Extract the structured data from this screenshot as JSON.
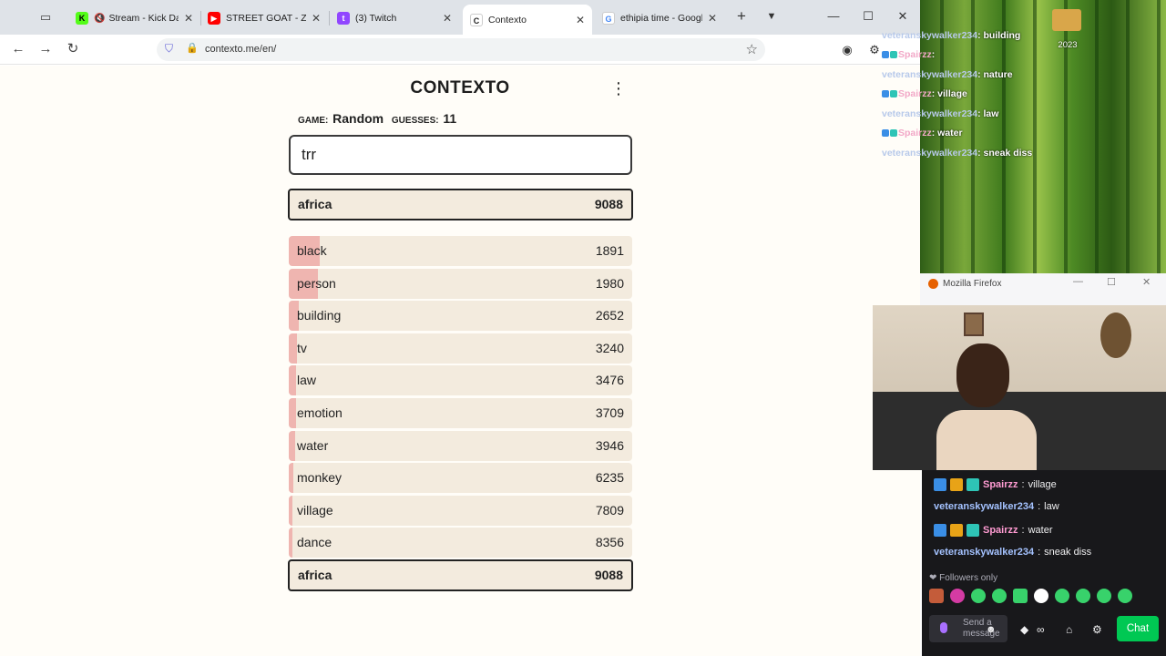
{
  "browser": {
    "tabs": [
      {
        "title": "Stream - Kick Dashboard",
        "favicon": "kick-icon",
        "color": "#53fc18",
        "muted": true
      },
      {
        "title": "STREET GOAT - ZEOTE",
        "favicon": "youtube-icon",
        "color": "#ff0000"
      },
      {
        "title": "(3) Twitch",
        "favicon": "twitch-icon",
        "color": "#9146ff"
      },
      {
        "title": "Contexto",
        "favicon": "contexto-icon",
        "color": "#222222",
        "active": true
      },
      {
        "title": "ethipia time - Google",
        "favicon": "google-icon",
        "color": "#4285f4"
      }
    ],
    "url": "contexto.me/en/"
  },
  "game": {
    "title": "CONTEXTO",
    "game_label": "GAME:",
    "game_value": "Random",
    "guesses_label": "GUESSES:",
    "guesses_value": "11",
    "input_value": "trr",
    "last_guess": {
      "word": "africa",
      "rank": "9088"
    },
    "guesses": [
      {
        "word": "black",
        "rank": "1891",
        "closeness": 0.09
      },
      {
        "word": "person",
        "rank": "1980",
        "closeness": 0.085
      },
      {
        "word": "building",
        "rank": "2652",
        "closeness": 0.03
      },
      {
        "word": "tv",
        "rank": "3240",
        "closeness": 0.025
      },
      {
        "word": "law",
        "rank": "3476",
        "closeness": 0.022
      },
      {
        "word": "emotion",
        "rank": "3709",
        "closeness": 0.02
      },
      {
        "word": "water",
        "rank": "3946",
        "closeness": 0.018
      },
      {
        "word": "monkey",
        "rank": "6235",
        "closeness": 0.012
      },
      {
        "word": "village",
        "rank": "7809",
        "closeness": 0.01
      },
      {
        "word": "dance",
        "rank": "8356",
        "closeness": 0.008
      },
      {
        "word": "africa",
        "rank": "9088",
        "closeness": 0.005,
        "highlight": true
      }
    ]
  },
  "overlay": {
    "year": "2023",
    "chat": [
      {
        "user": "veteranskywalker234",
        "msg": " : building",
        "badges": false
      },
      {
        "user": "Spairzz",
        "msg": " : ",
        "badges": true
      },
      {
        "user": "veteranskywalker234",
        "msg": " : nature",
        "badges": false
      },
      {
        "user": "Spairzz",
        "msg": " : village",
        "badges": true
      },
      {
        "user": "veteranskywalker234",
        "msg": " : law",
        "badges": false
      },
      {
        "user": "Spairzz",
        "msg": " : water",
        "badges": true
      },
      {
        "user": "veteranskywalker234",
        "msg": " : sneak diss",
        "badges": false
      }
    ],
    "firefox_title": "Mozilla Firefox"
  },
  "twitch_chat": {
    "messages": [
      {
        "user": "Spairzz",
        "msg": "village",
        "badges": true,
        "color": "#ff9bd2"
      },
      {
        "user": "veteranskywalker234",
        "msg": "law",
        "badges": false,
        "color": "#a4c2ff"
      },
      {
        "user": "Spairzz",
        "msg": "water",
        "badges": true,
        "color": "#ff9bd2"
      },
      {
        "user": "veteranskywalker234",
        "msg": "sneak diss",
        "badges": false,
        "color": "#a4c2ff"
      }
    ],
    "followers_only": "Followers only",
    "send_placeholder": "Send a message",
    "chat_button": "Chat"
  },
  "colors": {
    "accent_bar": "#efb5b0",
    "row_bg": "#f3ebde",
    "chat_green": "#00c853"
  }
}
